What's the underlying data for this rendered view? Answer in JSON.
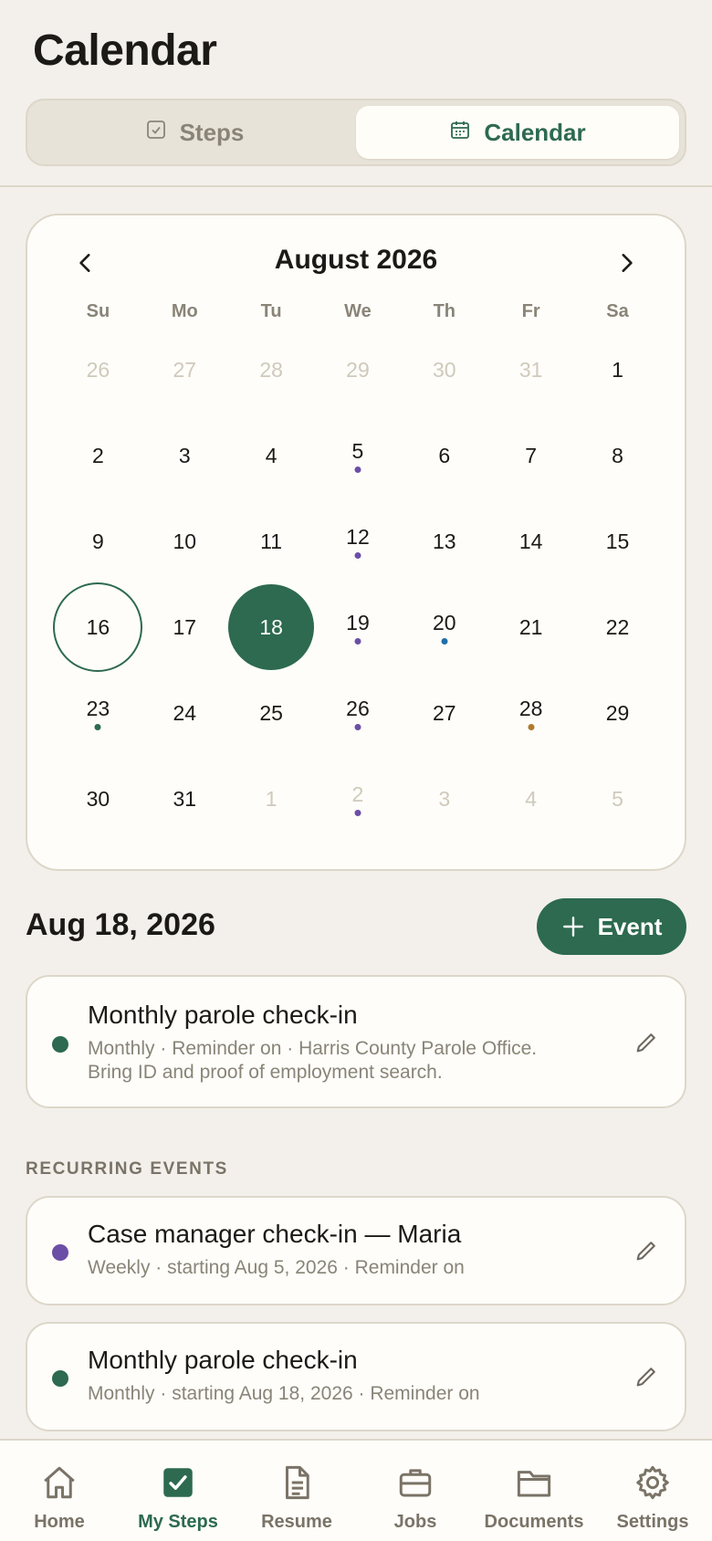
{
  "header": {
    "title": "Calendar"
  },
  "segmented": {
    "steps_label": "Steps",
    "calendar_label": "Calendar"
  },
  "calendar": {
    "month_label": "August 2026",
    "weekdays": [
      "Su",
      "Mo",
      "Tu",
      "We",
      "Th",
      "Fr",
      "Sa"
    ],
    "weeks": [
      [
        {
          "d": "26",
          "muted": true
        },
        {
          "d": "27",
          "muted": true
        },
        {
          "d": "28",
          "muted": true
        },
        {
          "d": "29",
          "muted": true
        },
        {
          "d": "30",
          "muted": true
        },
        {
          "d": "31",
          "muted": true
        },
        {
          "d": "1"
        }
      ],
      [
        {
          "d": "2"
        },
        {
          "d": "3"
        },
        {
          "d": "4"
        },
        {
          "d": "5",
          "dot": "#6b4ea6"
        },
        {
          "d": "6"
        },
        {
          "d": "7"
        },
        {
          "d": "8"
        }
      ],
      [
        {
          "d": "9"
        },
        {
          "d": "10"
        },
        {
          "d": "11"
        },
        {
          "d": "12",
          "dot": "#6b4ea6"
        },
        {
          "d": "13"
        },
        {
          "d": "14"
        },
        {
          "d": "15"
        }
      ],
      [
        {
          "d": "16",
          "today": true
        },
        {
          "d": "17"
        },
        {
          "d": "18",
          "selected": true
        },
        {
          "d": "19",
          "dot": "#6b4ea6"
        },
        {
          "d": "20",
          "dot": "#1f6fa8"
        },
        {
          "d": "21"
        },
        {
          "d": "22"
        }
      ],
      [
        {
          "d": "23",
          "dot": "#2d6a4f"
        },
        {
          "d": "24"
        },
        {
          "d": "25"
        },
        {
          "d": "26",
          "dot": "#6b4ea6"
        },
        {
          "d": "27"
        },
        {
          "d": "28",
          "dot": "#b07a2e"
        },
        {
          "d": "29"
        }
      ],
      [
        {
          "d": "30"
        },
        {
          "d": "31"
        },
        {
          "d": "1",
          "muted": true
        },
        {
          "d": "2",
          "muted": true,
          "dot": "#6b4ea6"
        },
        {
          "d": "3",
          "muted": true
        },
        {
          "d": "4",
          "muted": true
        },
        {
          "d": "5",
          "muted": true
        }
      ]
    ]
  },
  "selected_day": {
    "date_label": "Aug 18, 2026",
    "add_label": "Event"
  },
  "day_events": [
    {
      "title": "Monthly parole check-in",
      "subtitle": "Monthly · Reminder on · Harris County Parole Office. Bring ID and proof of employment search.",
      "color": "#2d6a4f"
    }
  ],
  "recurring": {
    "section_label": "RECURRING EVENTS",
    "items": [
      {
        "title": "Case manager check-in — Maria",
        "subtitle": "Weekly · starting Aug 5, 2026 · Reminder on",
        "color": "#6b4ea6"
      },
      {
        "title": "Monthly parole check-in",
        "subtitle": "Monthly · starting Aug 18, 2026 · Reminder on",
        "color": "#2d6a4f"
      }
    ]
  },
  "tabbar": {
    "items": [
      {
        "label": "Home",
        "icon": "home-icon"
      },
      {
        "label": "My Steps",
        "icon": "check-square-icon"
      },
      {
        "label": "Resume",
        "icon": "document-icon"
      },
      {
        "label": "Jobs",
        "icon": "briefcase-icon"
      },
      {
        "label": "Documents",
        "icon": "folder-icon"
      },
      {
        "label": "Settings",
        "icon": "gear-icon"
      }
    ],
    "active": "My Steps"
  },
  "colors": {
    "accent": "#2d6a4f",
    "background": "#f3f0eb",
    "card": "#fefdf9",
    "muted_text": "#8a8478"
  }
}
